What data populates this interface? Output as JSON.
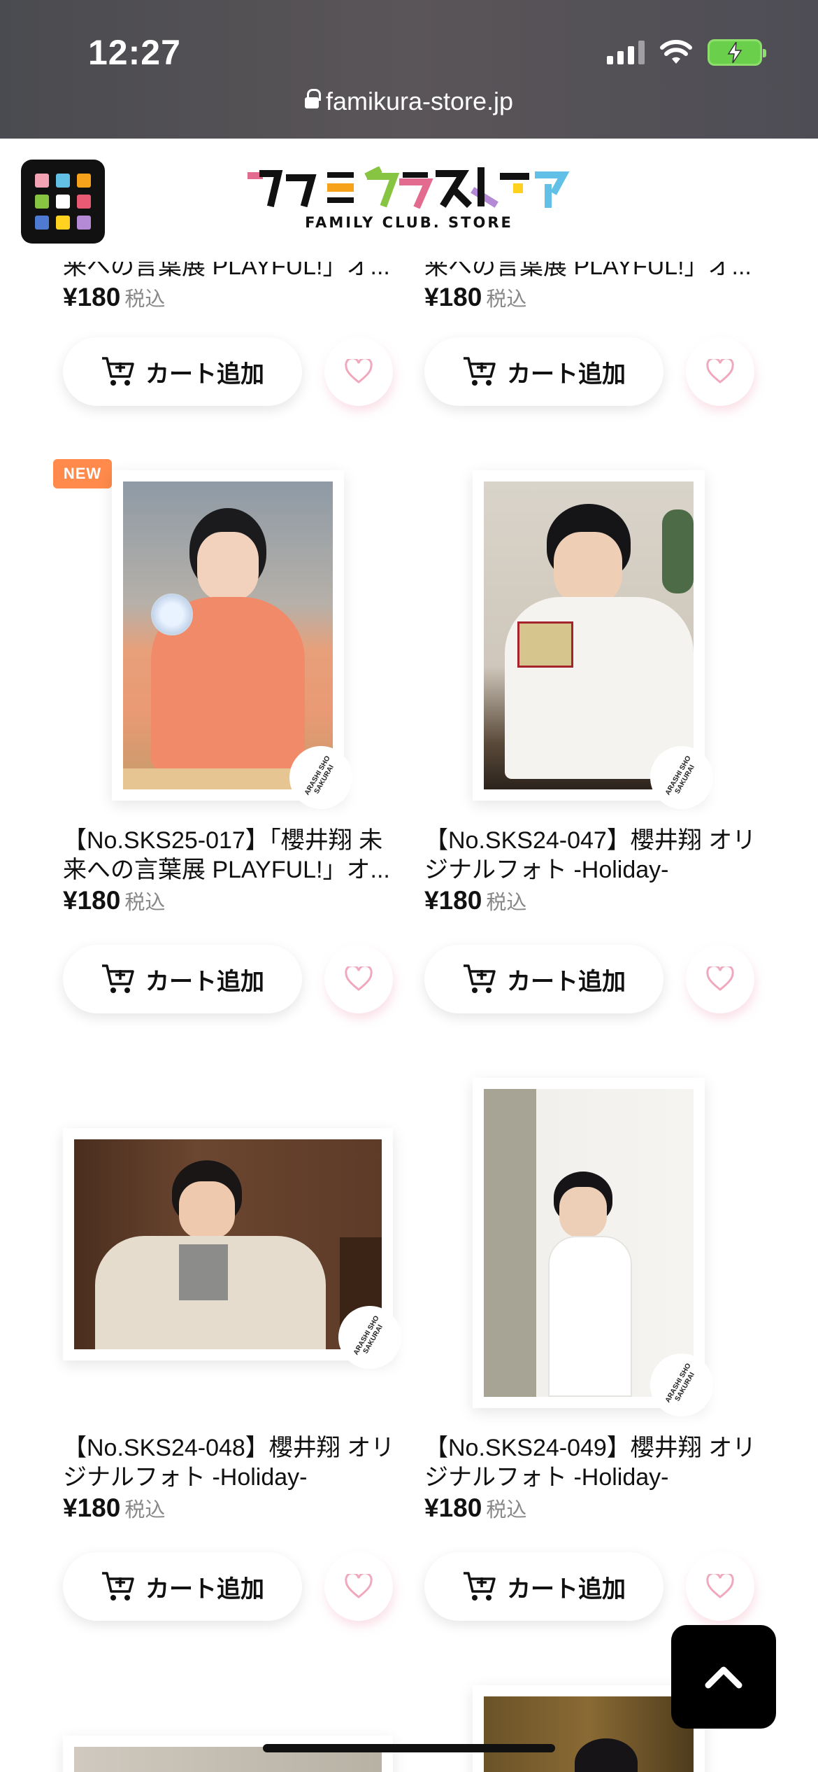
{
  "status_bar": {
    "time": "12:27",
    "url": "famikura-store.jp"
  },
  "header": {
    "logo_text": "ファミクラストア",
    "logo_sub": "FAMILY CLUB. STORE"
  },
  "colors": {
    "accent_new": "#ff8a4c",
    "heart": "#f0a8bc",
    "battery": "#6ad04b"
  },
  "products": [
    {
      "title": "来への言葉展 PLAYFUL!」オ...",
      "price": "¥180",
      "tax": "税込",
      "cart": "カート追加"
    },
    {
      "title": "来への言葉展 PLAYFUL!」オ...",
      "price": "¥180",
      "tax": "税込",
      "cart": "カート追加"
    },
    {
      "badge": "NEW",
      "title1": "【No.SKS25-017】「櫻井翔 未",
      "title2": "来への言葉展 PLAYFUL!」オ...",
      "price": "¥180",
      "tax": "税込",
      "cart": "カート追加"
    },
    {
      "title1": "【No.SKS24-047】櫻井翔 オリ",
      "title2": "ジナルフォト -Holiday-",
      "price": "¥180",
      "tax": "税込",
      "cart": "カート追加"
    },
    {
      "title1": "【No.SKS24-048】櫻井翔 オリ",
      "title2": "ジナルフォト -Holiday-",
      "price": "¥180",
      "tax": "税込",
      "cart": "カート追加"
    },
    {
      "title1": "【No.SKS24-049】櫻井翔 オリ",
      "title2": "ジナルフォト -Holiday-",
      "price": "¥180",
      "tax": "税込",
      "cart": "カート追加"
    }
  ],
  "photo_stamp": "ARASHI SHO SAKURAI"
}
